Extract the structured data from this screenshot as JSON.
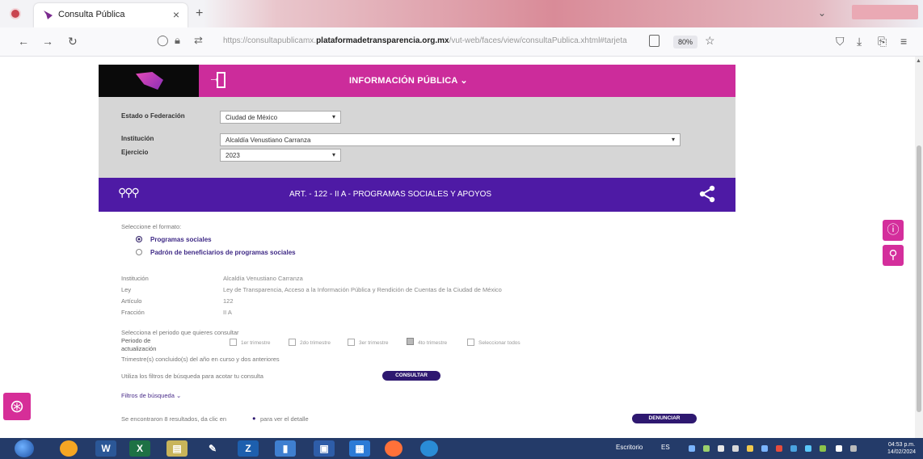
{
  "browser": {
    "tab_title": "Consulta Pública",
    "tab_close": "×",
    "new_tab": "+",
    "url_prefix": "https://consultapublicamx.",
    "url_domain": "plataformadetransparencia.org.mx",
    "url_suffix": "/vut-web/faces/view/consultaPublica.xhtml#tarjeta",
    "zoom": "80%"
  },
  "header": {
    "menu_title": "INFORMACIÓN PÚBLICA ⌄"
  },
  "filters": {
    "state_label": "Estado o Federación",
    "state_value": "Ciudad de México",
    "institution_label": "Institución",
    "institution_value": "Alcaldía Venustiano Carranza",
    "year_label": "Ejercicio",
    "year_value": "2023"
  },
  "section": {
    "title": "ART. - 122 - II A - PROGRAMAS SOCIALES Y APOYOS"
  },
  "format": {
    "prompt": "Seleccione el formato:",
    "options": [
      {
        "label": "Programas sociales",
        "selected": true
      },
      {
        "label": "Padrón de beneficiarios de programas sociales",
        "selected": false
      }
    ]
  },
  "info": {
    "rows": [
      {
        "key": "Institución",
        "value": "Alcaldía Venustiano Carranza"
      },
      {
        "key": "Ley",
        "value": "Ley de Transparencia, Acceso a la Información Pública y Rendición de Cuentas de la Ciudad de México"
      },
      {
        "key": "Artículo",
        "value": "122"
      },
      {
        "key": "Fracción",
        "value": "II A"
      }
    ]
  },
  "period": {
    "prompt": "Selecciona el periodo que quieres consultar",
    "label_line1": "Periodo de",
    "label_line2": "actualización",
    "checks": [
      {
        "label": "1er trimestre",
        "checked": false
      },
      {
        "label": "2do trimestre",
        "checked": false
      },
      {
        "label": "3er trimestre",
        "checked": false
      },
      {
        "label": "4to trimestre",
        "checked": true
      },
      {
        "label": "Seleccionar todos",
        "checked": false
      }
    ],
    "note": "Trimestre(s) concluido(s) del año en curso y dos anteriores"
  },
  "search": {
    "hint": "Utiliza los filtros de búsqueda para acotar tu consulta",
    "button": "CONSULTAR",
    "filters_link": "Filtros de búsqueda ⌄",
    "results_text": "Se encontraron 8 resultados, da clic en",
    "results_tail": "para ver el detalle",
    "report_button": "DENUNCIAR"
  },
  "taskbar": {
    "desktop_label": "Escritorio",
    "lang": "ES",
    "time": "04:53 p.m.",
    "date": "14/02/2024"
  },
  "colors": {
    "magenta": "#cc2c9b",
    "purple": "#4e1aa5",
    "panel_gray": "#d6d6d6"
  }
}
